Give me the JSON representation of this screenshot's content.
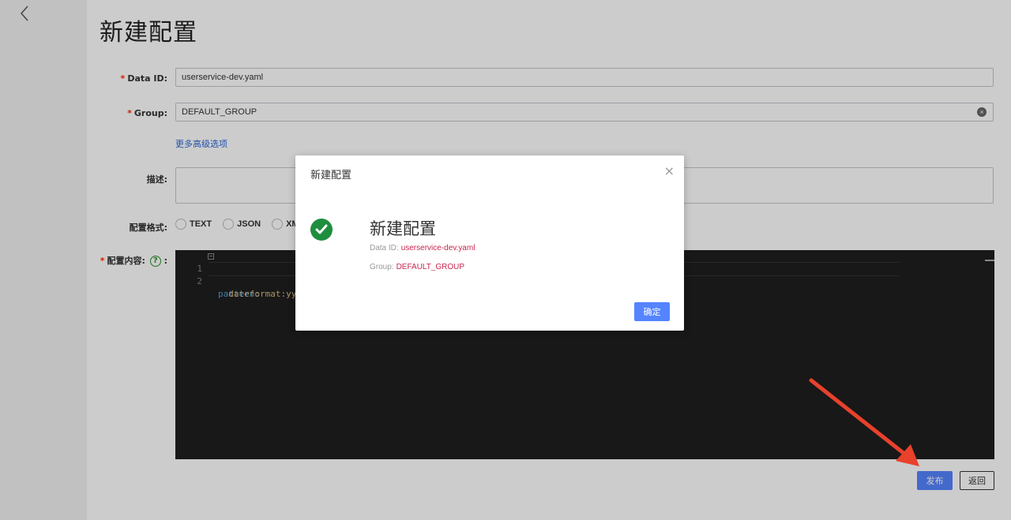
{
  "page": {
    "title": "新建配置"
  },
  "form": {
    "data_id": {
      "label": "Data ID:",
      "required_mark": "*",
      "value": "userservice-dev.yaml"
    },
    "group": {
      "label": "Group:",
      "required_mark": "*",
      "value": "DEFAULT_GROUP"
    },
    "advanced_link": "更多高级选项",
    "description": {
      "label": "描述:",
      "value": ""
    },
    "format": {
      "label": "配置格式:",
      "options": [
        "TEXT",
        "JSON",
        "XM"
      ]
    },
    "content": {
      "label": "配置内容:",
      "required_mark": "*",
      "help_glyph": "?",
      "suffix": ":",
      "lines": [
        {
          "no": "1",
          "text": "pattern:"
        },
        {
          "no": "2",
          "text": "  dateformat:yy"
        }
      ]
    }
  },
  "actions": {
    "publish": "发布",
    "back": "返回"
  },
  "dialog": {
    "title": "新建配置",
    "close_glyph": "×",
    "message_title": "新建配置",
    "data_id_label": "Data ID:",
    "data_id_value": "userservice-dev.yaml",
    "group_label": "Group:",
    "group_value": "DEFAULT_GROUP",
    "ok_label": "确定"
  },
  "colors": {
    "primary": "#5584ff",
    "success": "#1e8e3e",
    "highlight_value": "#c7254e",
    "annotation_arrow": "#e8412c"
  },
  "icons": {
    "back": "chevron-left-icon",
    "clear": "clear-circle-icon",
    "help": "question-circle-icon",
    "success": "check-circle-icon",
    "close": "close-icon"
  }
}
